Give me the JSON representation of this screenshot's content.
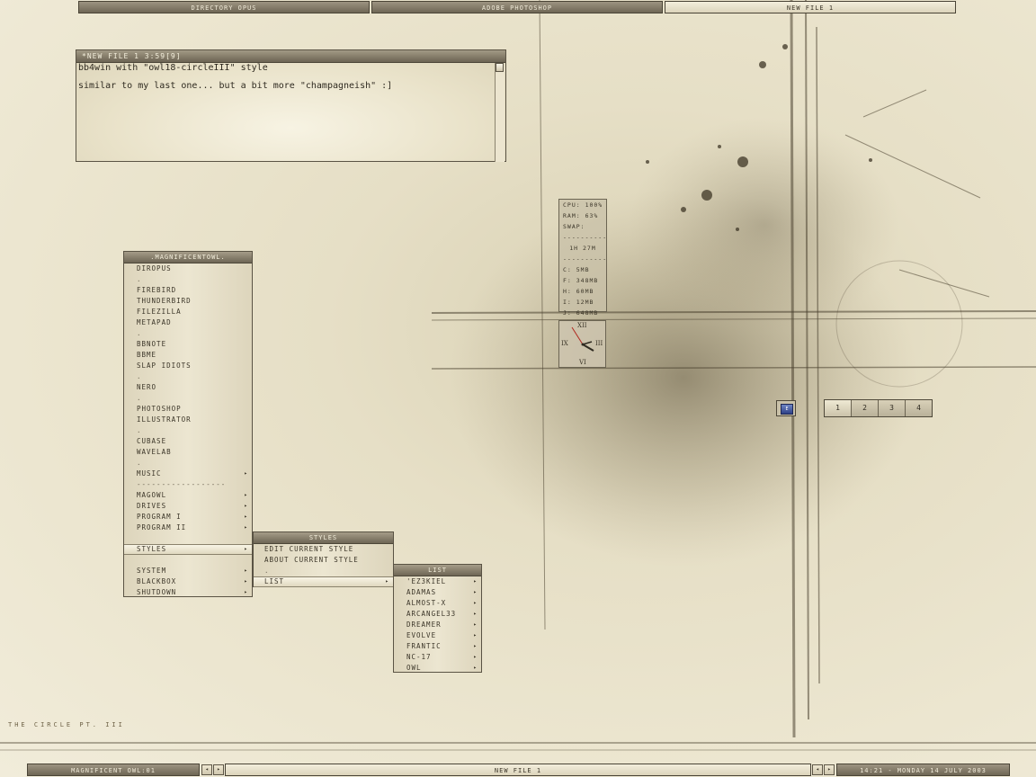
{
  "top_bar": {
    "tabs": [
      {
        "label": "DIRECTORY OPUS",
        "active": false
      },
      {
        "label": "ADOBE PHOTOSHOP",
        "active": false
      },
      {
        "label": "NEW FILE 1",
        "active": true
      }
    ]
  },
  "note_window": {
    "title": "*NEW FILE 1  3:59[9]",
    "lines": [
      "bb4win with \"owl18-circleIII\" style",
      "similar to my last one... but a bit more \"champagneish\" :]"
    ]
  },
  "main_menu": {
    "title": ".MAGNIFICENTOWL.",
    "items": [
      {
        "label": "DIROPUS"
      },
      {
        "label": "."
      },
      {
        "label": "FIREBIRD"
      },
      {
        "label": "THUNDERBIRD"
      },
      {
        "label": "FILEZILLA"
      },
      {
        "label": "METAPAD"
      },
      {
        "label": "."
      },
      {
        "label": "BBNOTE"
      },
      {
        "label": "BBME"
      },
      {
        "label": "SLAP IDIOTS"
      },
      {
        "label": "."
      },
      {
        "label": "NERO"
      },
      {
        "label": "."
      },
      {
        "label": "PHOTOSHOP"
      },
      {
        "label": "ILLUSTRATOR"
      },
      {
        "label": "."
      },
      {
        "label": "CUBASE"
      },
      {
        "label": "WAVELAB"
      },
      {
        "label": "."
      },
      {
        "label": "MUSIC"
      },
      {
        "label": "------------------"
      },
      {
        "label": "MAGOWL"
      },
      {
        "label": "DRIVES"
      },
      {
        "label": "PROGRAM I"
      },
      {
        "label": "PROGRAM II"
      },
      {
        "label": ""
      },
      {
        "label": "STYLES"
      },
      {
        "label": ""
      },
      {
        "label": "SYSTEM"
      },
      {
        "label": "BLACKBOX"
      },
      {
        "label": "SHUTDOWN"
      }
    ]
  },
  "styles_menu": {
    "title": "STYLES",
    "items": [
      {
        "label": "EDIT CURRENT STYLE"
      },
      {
        "label": "ABOUT CURRENT STYLE"
      },
      {
        "label": "."
      },
      {
        "label": "LIST"
      }
    ]
  },
  "list_menu": {
    "title": "LIST",
    "items": [
      {
        "label": "'EZ3KIEL"
      },
      {
        "label": "ADAMAS"
      },
      {
        "label": "ALMOST-X"
      },
      {
        "label": "ARCANGEL33"
      },
      {
        "label": "DREAMER"
      },
      {
        "label": "EVOLVE"
      },
      {
        "label": "FRANTIC"
      },
      {
        "label": "NC-17"
      },
      {
        "label": "OWL"
      }
    ]
  },
  "sysmon": {
    "cpu": "CPU: 100%",
    "ram": "RAM: 63%",
    "swap": "SWAP:",
    "sep1": "----------",
    "uptime": "1H 27M",
    "sep2": "----------",
    "drives": [
      "C: 5MB",
      "F: 348MB",
      "H: 60MB",
      "I: 12MB",
      "J: 648MB"
    ]
  },
  "clock": {
    "n12": "XII",
    "n3": "III",
    "n6": "VI",
    "n9": "IX"
  },
  "systray": {
    "icon": "E"
  },
  "pager": {
    "desktops": [
      "1",
      "2",
      "3",
      "4"
    ],
    "current": "1"
  },
  "footer_label": "THE  CIRCLE  PT. III",
  "bottom_bar": {
    "workspace": "MAGNIFICENT OWL:01",
    "prev": "◂",
    "next": "▸",
    "task": "NEW FILE 1",
    "task_prev": "◂",
    "task_next": "▸",
    "clock": "14:21 - MONDAY 14 JULY 2003"
  },
  "colors": {
    "accent": "#6e6655",
    "background": "#ece6d0",
    "text": "#3b3528"
  }
}
